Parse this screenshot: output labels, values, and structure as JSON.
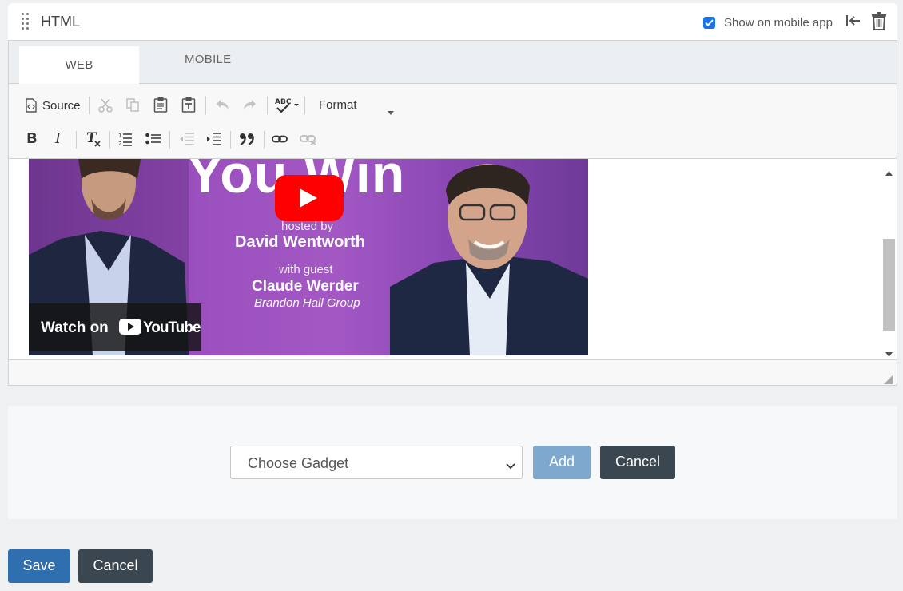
{
  "widget": {
    "title": "HTML",
    "show_on_mobile_label": "Show on mobile app",
    "show_on_mobile_checked": true
  },
  "tabs": [
    {
      "label": "WEB",
      "active": true
    },
    {
      "label": "MOBILE",
      "active": false
    }
  ],
  "toolbar": {
    "source_label": "Source",
    "format_label": "Format",
    "row1_icons": [
      "source-icon",
      "cut-icon",
      "copy-icon",
      "paste-icon",
      "paste-text-icon",
      "undo-icon",
      "redo-icon",
      "spellcheck-icon"
    ],
    "row2_icons": [
      "bold-icon",
      "italic-icon",
      "remove-format-icon",
      "numbered-list-icon",
      "bulleted-list-icon",
      "outdent-icon",
      "indent-icon",
      "blockquote-icon",
      "link-icon",
      "unlink-icon"
    ],
    "bold_glyph": "B",
    "italic_glyph": "I"
  },
  "video": {
    "title_fragment": "You Win",
    "hosted_by": "hosted by",
    "host_name": "David Wentworth",
    "with_guest": "with guest",
    "guest_name": "Claude Werder",
    "guest_org": "Brandon Hall Group",
    "watch_on": "Watch on",
    "youtube_label": "YouTube"
  },
  "gadget": {
    "select_value": "Choose Gadget",
    "add_label": "Add",
    "cancel_label": "Cancel"
  },
  "footer": {
    "save_label": "Save",
    "cancel_label": "Cancel"
  },
  "colors": {
    "primary": "#2f6fb0",
    "dark": "#3a4750",
    "add_disabled": "#7fa8cf",
    "checkbox": "#1a73e8",
    "youtube_red": "#ff0000"
  }
}
